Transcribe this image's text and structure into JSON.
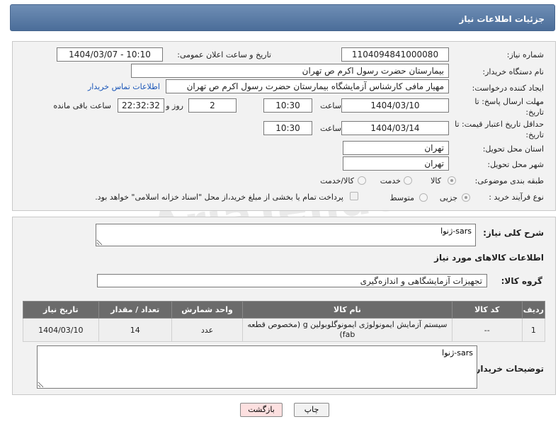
{
  "page_title": "جزئیات اطلاعات نیاز",
  "fields": {
    "need_number_label": "شماره نیاز:",
    "need_number": "1104094841000080",
    "announce_label": "تاریخ و ساعت اعلان عمومی:",
    "announce_value": "1404/03/07 - 10:10",
    "buyer_org_label": "نام دستگاه خریدار:",
    "buyer_org": "بیمارستان حضرت رسول اکرم ص  تهران",
    "creator_label": "ایجاد کننده درخواست:",
    "creator": "مهیار مافی کارشناس آزمایشگاه بیمارستان حضرت رسول اکرم ص  تهران",
    "buyer_contact_link": "اطلاعات تماس خریدار",
    "reply_deadline_label": "مهلت ارسال پاسخ: تا تاریخ:",
    "reply_date": "1404/03/10",
    "time_label": "ساعت",
    "reply_time": "10:30",
    "days": "2",
    "days_label": "روز و",
    "remaining_time": "22:32:32",
    "remaining_label": "ساعت باقی مانده",
    "price_validity_label": "حداقل تاریخ اعتبار قیمت: تا تاریخ:",
    "price_date": "1404/03/14",
    "price_time": "10:30",
    "province_label": "استان محل تحویل:",
    "province": "تهران",
    "city_label": "شهر محل تحویل:",
    "city": "تهران",
    "category_label": "طبقه بندی موضوعی:",
    "category_options": [
      "کالا",
      "خدمت",
      "کالا/خدمت"
    ],
    "process_label": "نوع فرآیند خرید :",
    "process_options": [
      "جزیی",
      "متوسط"
    ],
    "payment_note": "پرداخت تمام یا بخشی از مبلغ خرید،از محل \"اسناد خزانه اسلامی\" خواهد بود."
  },
  "description": {
    "label": "شرح کلی نیاز:",
    "value": "sars-ژنوا"
  },
  "goods_info_title": "اطلاعات کالاهای مورد نیاز",
  "goods_group": {
    "label": "گروه کالا:",
    "value": "تجهیزات آزمایشگاهی و اندازه‌گیری"
  },
  "table": {
    "headers": [
      "ردیف",
      "کد کالا",
      "نام کالا",
      "واحد شمارش",
      "تعداد / مقدار",
      "تاریخ نیاز"
    ],
    "rows": [
      [
        "1",
        "--",
        "سیستم آزمایش ایمونولوژی ایمونوگلوبولین g (مخصوص قطعه fab)",
        "عدد",
        "14",
        "1404/03/10"
      ]
    ]
  },
  "buyer_notes": {
    "label": "توضیحات خریدار:",
    "value": "sars-ژنوا"
  },
  "buttons": {
    "print": "چاپ",
    "back": "بازگشت"
  },
  "watermark": "AriaTender.net"
}
